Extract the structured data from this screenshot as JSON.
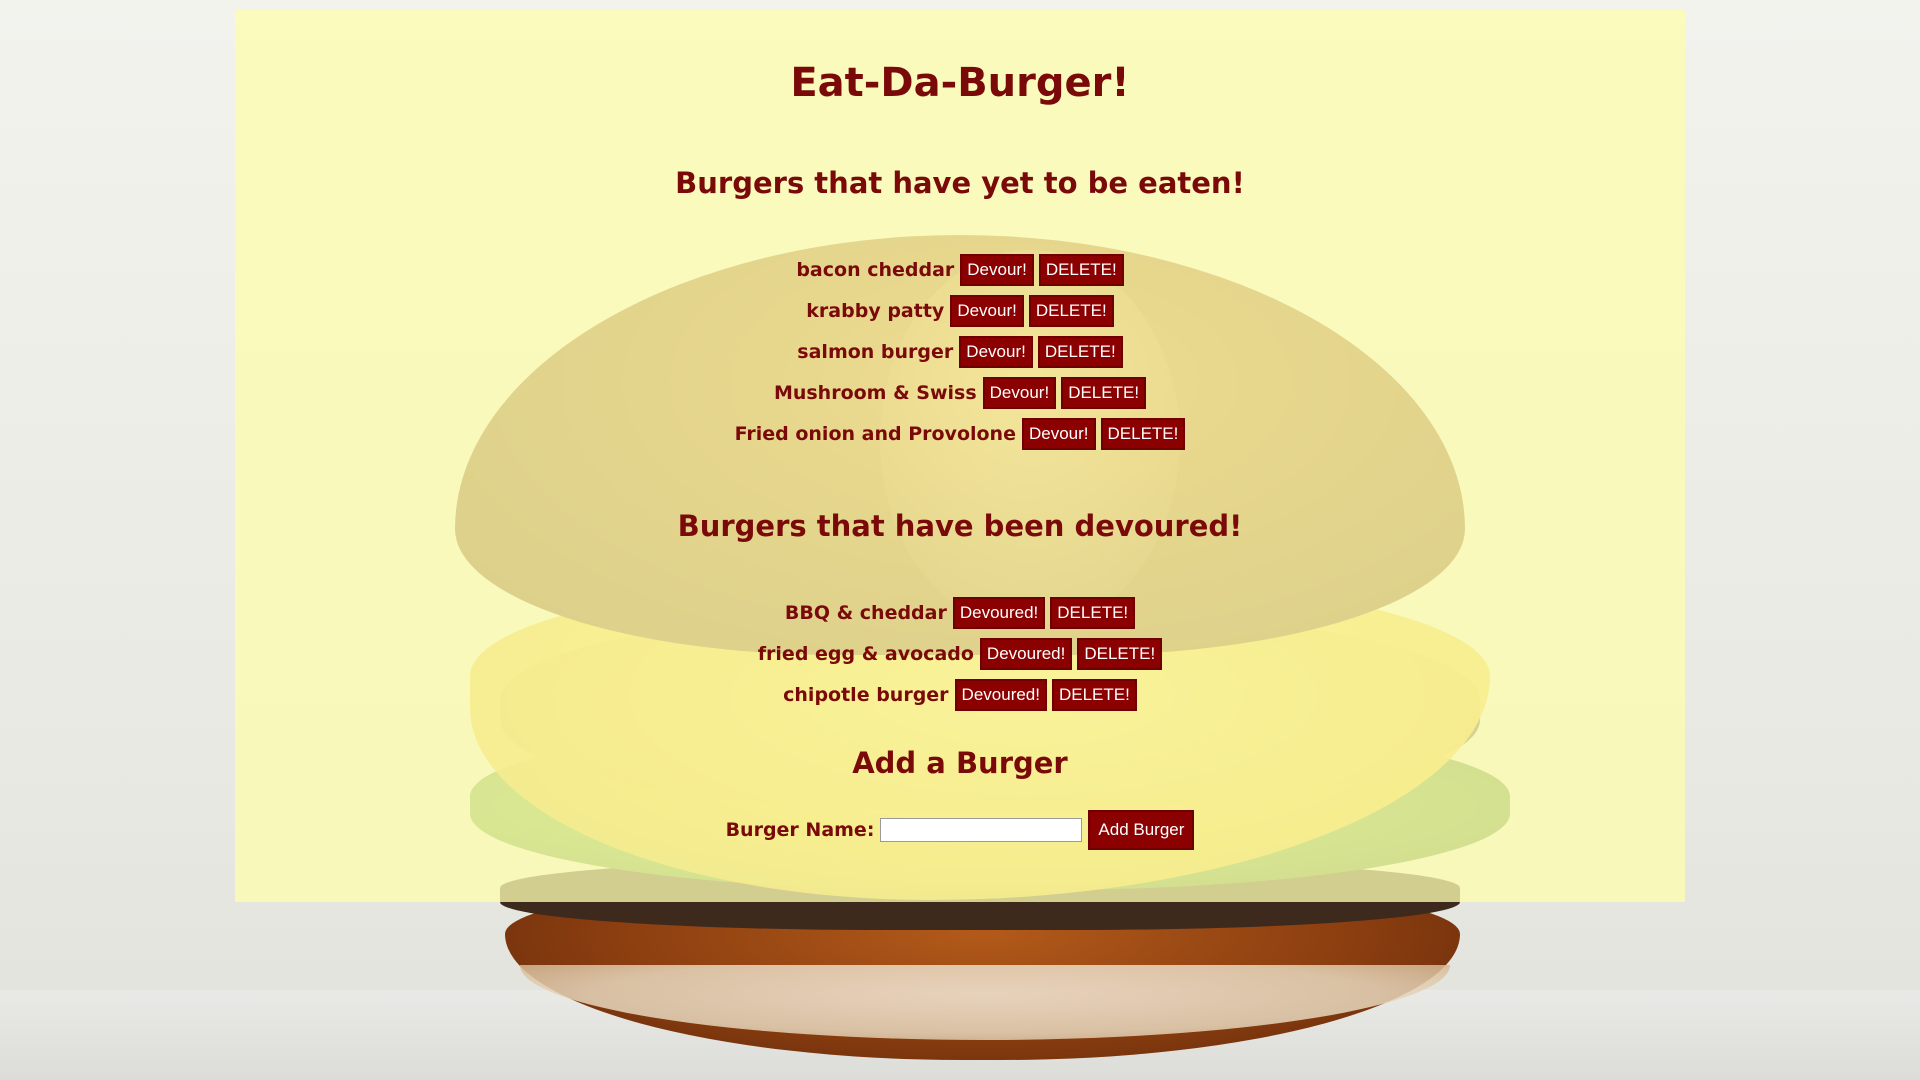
{
  "page": {
    "title": "Eat-Da-Burger!"
  },
  "uneaten": {
    "heading": "Burgers that have yet to be eaten!",
    "items": [
      {
        "name": "bacon cheddar",
        "action": "Devour!",
        "delete": "DELETE!"
      },
      {
        "name": "krabby patty",
        "action": "Devour!",
        "delete": "DELETE!"
      },
      {
        "name": "salmon burger",
        "action": "Devour!",
        "delete": "DELETE!"
      },
      {
        "name": "Mushroom & Swiss",
        "action": "Devour!",
        "delete": "DELETE!"
      },
      {
        "name": "Fried onion and Provolone",
        "action": "Devour!",
        "delete": "DELETE!"
      }
    ]
  },
  "devoured": {
    "heading": "Burgers that have been devoured!",
    "items": [
      {
        "name": "BBQ & cheddar",
        "action": "Devoured!",
        "delete": "DELETE!"
      },
      {
        "name": "fried egg & avocado",
        "action": "Devoured!",
        "delete": "DELETE!"
      },
      {
        "name": "chipotle burger",
        "action": "Devoured!",
        "delete": "DELETE!"
      }
    ]
  },
  "add_form": {
    "heading": "Add a Burger",
    "label": "Burger Name:",
    "input_value": "",
    "button": "Add Burger"
  },
  "colors": {
    "panel": "#fcfcb0",
    "text": "#7a0a0a",
    "button_bg": "#8b0000",
    "button_text": "#ffffff"
  }
}
